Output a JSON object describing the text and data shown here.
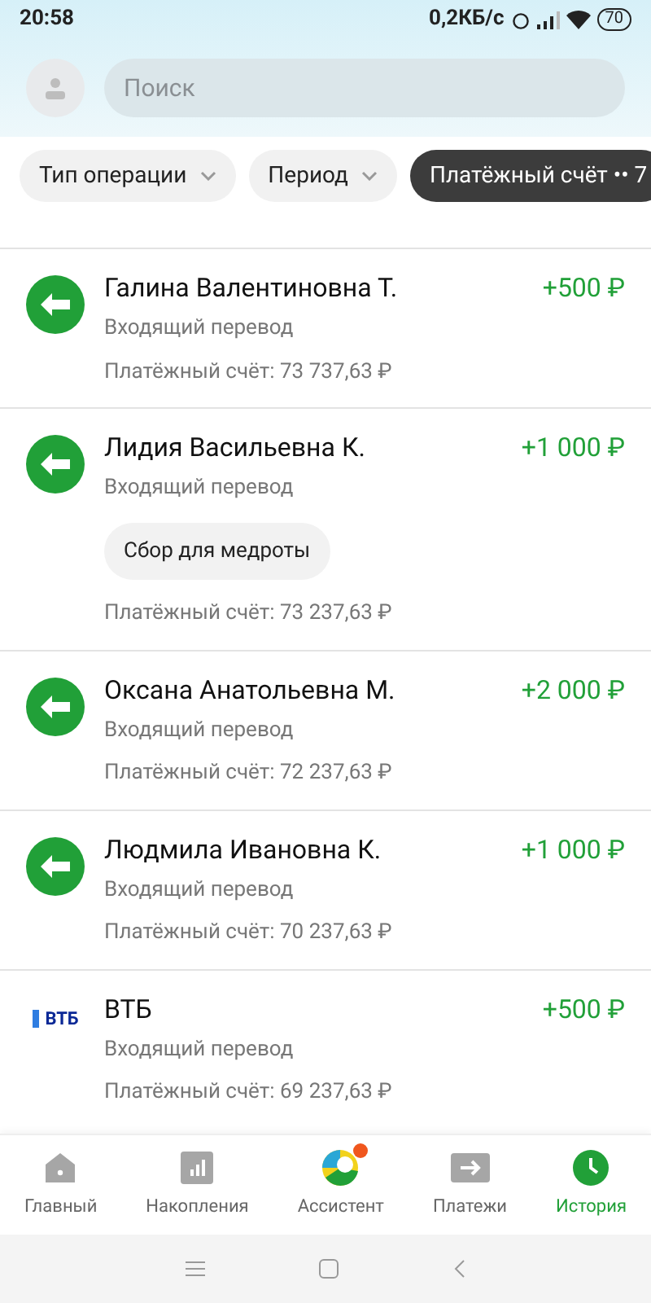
{
  "status_bar": {
    "time": "20:58",
    "speed": "0,2КБ/с",
    "battery": "70"
  },
  "search": {
    "placeholder": "Поиск"
  },
  "filters": [
    {
      "label": "Тип операции",
      "kind": "dropdown",
      "selected": false
    },
    {
      "label": "Период",
      "kind": "dropdown",
      "selected": false
    },
    {
      "label": "Платёжный счёт •• 7",
      "kind": "account",
      "selected": true
    }
  ],
  "transactions": [
    {
      "kind": "arrow",
      "name": "Галина Валентиновна Т.",
      "amount": "+500 ₽",
      "type": "Входящий перевод",
      "balance": "Платёжный счёт: 73 737,63 ₽"
    },
    {
      "kind": "arrow",
      "name": "Лидия Васильевна К.",
      "amount": "+1 000 ₽",
      "type": "Входящий перевод",
      "message": "Сбор для медроты",
      "balance": "Платёжный счёт: 73 237,63 ₽"
    },
    {
      "kind": "arrow",
      "name": "Оксана Анатольевна М.",
      "amount": "+2 000 ₽",
      "type": "Входящий перевод",
      "balance": "Платёжный счёт: 72 237,63 ₽"
    },
    {
      "kind": "arrow",
      "name": "Людмила Ивановна К.",
      "amount": "+1 000 ₽",
      "type": "Входящий перевод",
      "balance": "Платёжный счёт: 70 237,63 ₽"
    },
    {
      "kind": "logo",
      "logo_text": "ВТБ",
      "name": "ВТБ",
      "amount": "+500 ₽",
      "type": "Входящий перевод",
      "balance": "Платёжный счёт: 69 237,63 ₽"
    }
  ],
  "nav": [
    {
      "label": "Главный",
      "kind": "home",
      "selected": false,
      "badge": false
    },
    {
      "label": "Накопления",
      "kind": "chart",
      "selected": false,
      "badge": false
    },
    {
      "label": "Ассистент",
      "kind": "assistant",
      "selected": false,
      "badge": true
    },
    {
      "label": "Платежи",
      "kind": "transfer",
      "selected": false,
      "badge": false
    },
    {
      "label": "История",
      "kind": "clock",
      "selected": true,
      "badge": false
    }
  ]
}
